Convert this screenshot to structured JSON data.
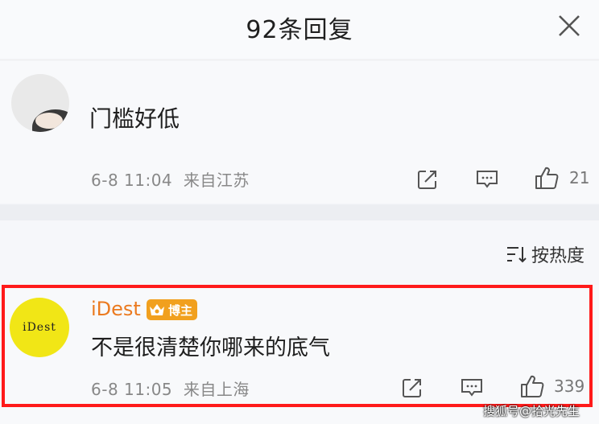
{
  "header": {
    "title": "92条回复"
  },
  "comment1": {
    "text": "门槛好低",
    "time": "6-8 11:04",
    "location": "来自江苏",
    "like_count": "21"
  },
  "sort": {
    "label": "按热度"
  },
  "comment2": {
    "avatar_text": "iDest",
    "username": "iDest",
    "badge": "博主",
    "text": "不是很清楚你哪来的底气",
    "time": "6-8 11:05",
    "location": "来自上海",
    "like_count": "339"
  },
  "watermark": "搜狐号@拾光先生",
  "colors": {
    "username": "#eb7a1f",
    "badge": "#f1a01e",
    "highlight_border": "#ff1a1a",
    "avatar_bg": "#f1e616"
  }
}
